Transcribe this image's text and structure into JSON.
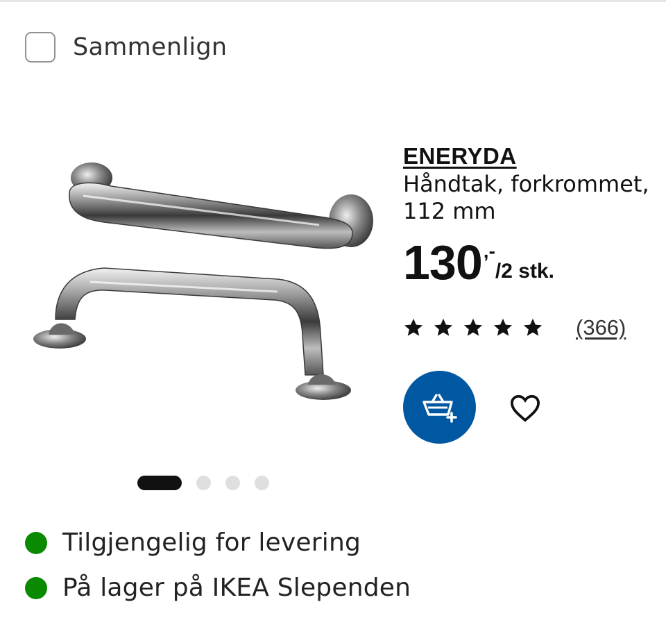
{
  "compare": {
    "label": "Sammenlign"
  },
  "product": {
    "name": "ENERYDA",
    "description_line1": "Håndtak, forkrommet,",
    "description_line2": "112 mm",
    "price": {
      "amount": "130",
      "suffix": ",-",
      "unit": "/2 stk."
    },
    "rating": {
      "stars": 5,
      "review_count": "(366)"
    }
  },
  "carousel": {
    "total": 4,
    "active": 1
  },
  "availability": [
    {
      "label": "Tilgjengelig for levering",
      "status_color": "#0a8a00"
    },
    {
      "label": "På lager på IKEA Slependen",
      "status_color": "#0a8a00"
    }
  ],
  "colors": {
    "brand_blue": "#0058a3",
    "available_green": "#0a8a00"
  },
  "icons": {
    "cart": "add-to-cart-icon",
    "favourite": "heart-icon",
    "star": "star-icon"
  }
}
